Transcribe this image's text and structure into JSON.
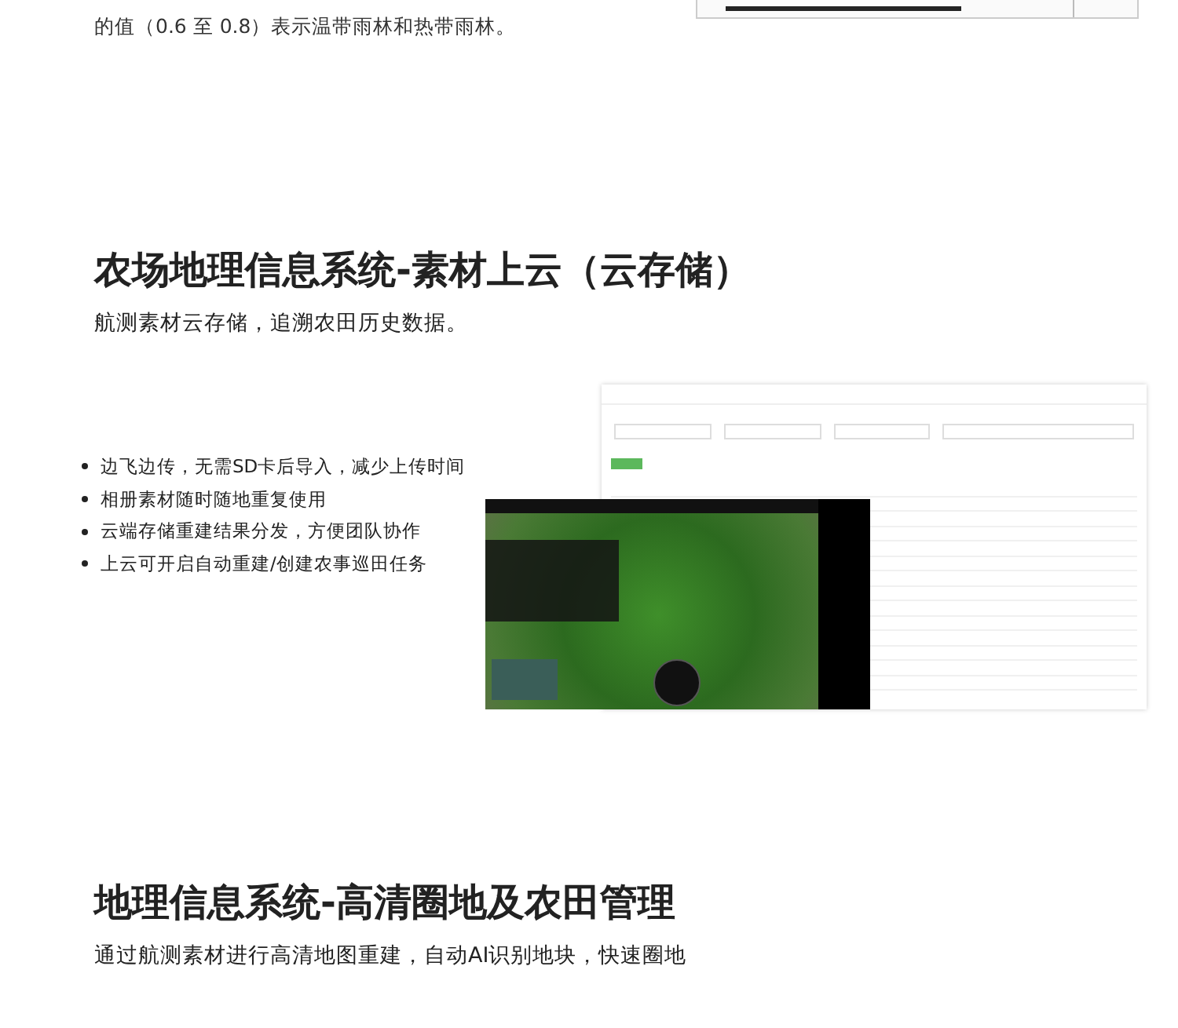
{
  "intro": {
    "text": "的值（0.6 至 0.8）表示温带雨林和热带雨林。"
  },
  "sections": [
    {
      "title": "农场地理信息系统-素材上云（云存储）",
      "subtitle": "航测素材云存储，追溯农田历史数据。",
      "bullets": [
        "边飞边传，无需SD卡后导入，减少上传时间",
        "相册素材随时随地重复使用",
        "云端存储重建结果分发，方便团队协作",
        "上云可开启自动重建/创建农事巡田任务"
      ]
    },
    {
      "title": "地理信息系统-高清圈地及农田管理",
      "subtitle": "通过航测素材进行高清地图重建，自动AI识别地块，快速圈地"
    }
  ]
}
